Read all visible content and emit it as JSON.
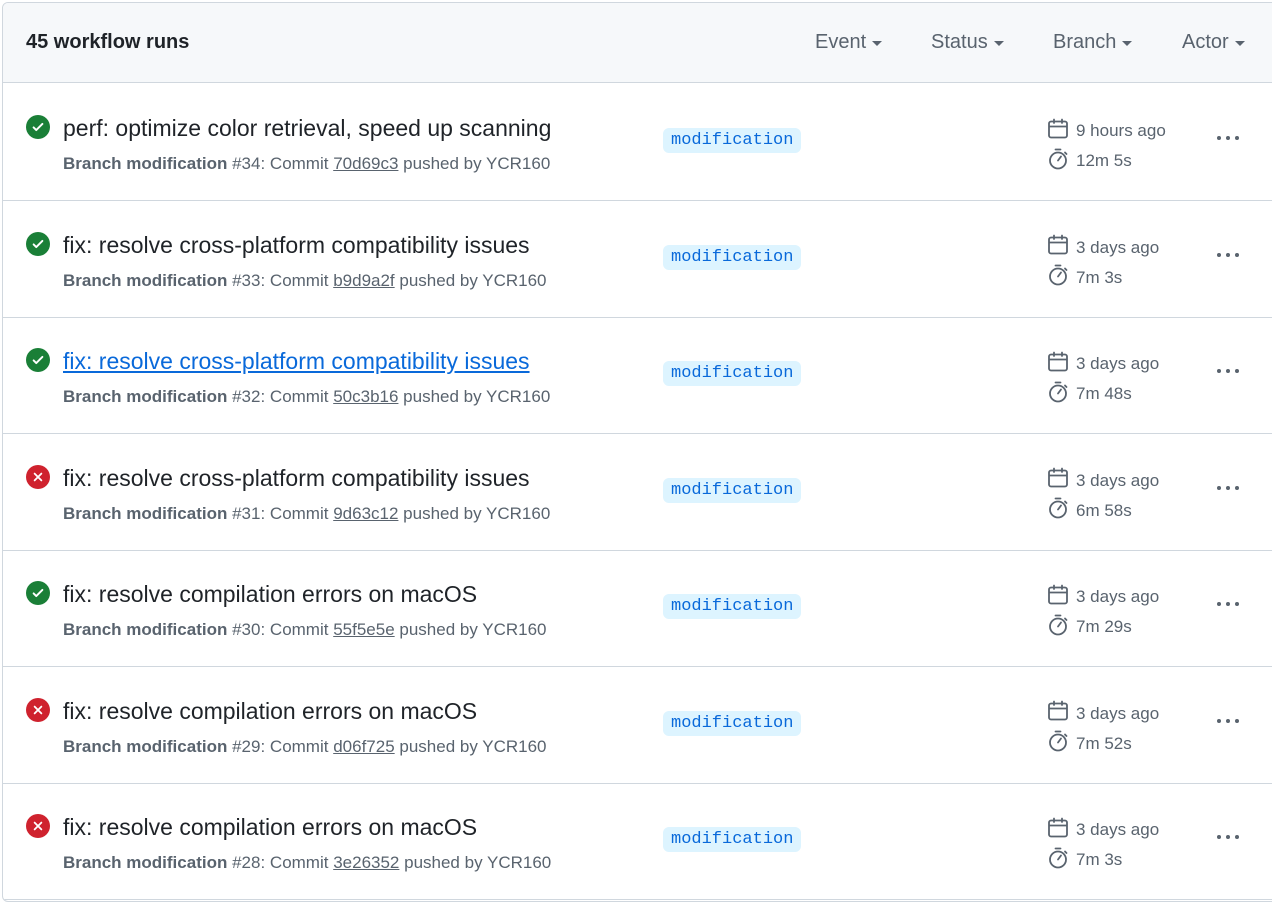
{
  "header": {
    "title": "45 workflow runs",
    "filters": [
      {
        "label": "Event"
      },
      {
        "label": "Status"
      },
      {
        "label": "Branch"
      },
      {
        "label": "Actor"
      }
    ]
  },
  "colors": {
    "success": "#1a7f37",
    "failure": "#cf222e",
    "link": "#0969da",
    "badge_bg": "#ddf4ff"
  },
  "runs": [
    {
      "status": "success",
      "title": "perf: optimize color retrieval, speed up scanning",
      "branch_label": "Branch modification",
      "run_number": "#34",
      "commit_prefix": ": Commit ",
      "sha": "70d69c3",
      "pushed_by": " pushed by YCR160",
      "branch": "modification",
      "when": "9 hours ago",
      "duration": "12m 5s",
      "highlighted": false
    },
    {
      "status": "success",
      "title": "fix: resolve cross-platform compatibility issues",
      "branch_label": "Branch modification",
      "run_number": "#33",
      "commit_prefix": ": Commit ",
      "sha": "b9d9a2f",
      "pushed_by": " pushed by YCR160",
      "branch": "modification",
      "when": "3 days ago",
      "duration": "7m 3s",
      "highlighted": false
    },
    {
      "status": "success",
      "title": "fix: resolve cross-platform compatibility issues",
      "branch_label": "Branch modification",
      "run_number": "#32",
      "commit_prefix": ": Commit ",
      "sha": "50c3b16",
      "pushed_by": " pushed by YCR160",
      "branch": "modification",
      "when": "3 days ago",
      "duration": "7m 48s",
      "highlighted": true
    },
    {
      "status": "failure",
      "title": "fix: resolve cross-platform compatibility issues",
      "branch_label": "Branch modification",
      "run_number": "#31",
      "commit_prefix": ": Commit ",
      "sha": "9d63c12",
      "pushed_by": " pushed by YCR160",
      "branch": "modification",
      "when": "3 days ago",
      "duration": "6m 58s",
      "highlighted": false
    },
    {
      "status": "success",
      "title": "fix: resolve compilation errors on macOS",
      "branch_label": "Branch modification",
      "run_number": "#30",
      "commit_prefix": ": Commit ",
      "sha": "55f5e5e",
      "pushed_by": " pushed by YCR160",
      "branch": "modification",
      "when": "3 days ago",
      "duration": "7m 29s",
      "highlighted": false
    },
    {
      "status": "failure",
      "title": "fix: resolve compilation errors on macOS",
      "branch_label": "Branch modification",
      "run_number": "#29",
      "commit_prefix": ": Commit ",
      "sha": "d06f725",
      "pushed_by": " pushed by YCR160",
      "branch": "modification",
      "when": "3 days ago",
      "duration": "7m 52s",
      "highlighted": false
    },
    {
      "status": "failure",
      "title": "fix: resolve compilation errors on macOS",
      "branch_label": "Branch modification",
      "run_number": "#28",
      "commit_prefix": ": Commit ",
      "sha": "3e26352",
      "pushed_by": " pushed by YCR160",
      "branch": "modification",
      "when": "3 days ago",
      "duration": "7m 3s",
      "highlighted": false
    }
  ]
}
